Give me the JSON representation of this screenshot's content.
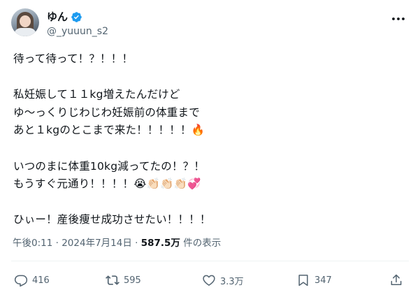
{
  "author": {
    "display_name": "ゆん",
    "handle": "@_yuuun_s2"
  },
  "tweet": {
    "text": "待って待って！？！！！\n\n私妊娠して１１kg増えたんだけど\nゆ〜っくりじわじわ妊娠前の体重まで\nあと１kgのとこまで来た！！！！！🔥\n\nいつのまに体重10kg減ってたの！？！\nもうすぐ元通り！！！！😭👏🏻👏🏻👏🏻💞\n\nひぃー！産後痩せ成功させたい！！！！",
    "time": "午後0:11",
    "separator": "·",
    "date": "2024年7月14日",
    "views_count": "587.5万",
    "views_label": "件の表示"
  },
  "actions": {
    "replies": "416",
    "reposts": "595",
    "likes": "3.3万",
    "bookmarks": "347"
  },
  "icons": [
    "verified-badge-icon",
    "more-icon",
    "reply-icon",
    "repost-icon",
    "like-icon",
    "bookmark-icon",
    "share-icon"
  ],
  "colors": {
    "verified": "#1d9bf0",
    "text": "#0f1419",
    "secondary": "#536471"
  }
}
